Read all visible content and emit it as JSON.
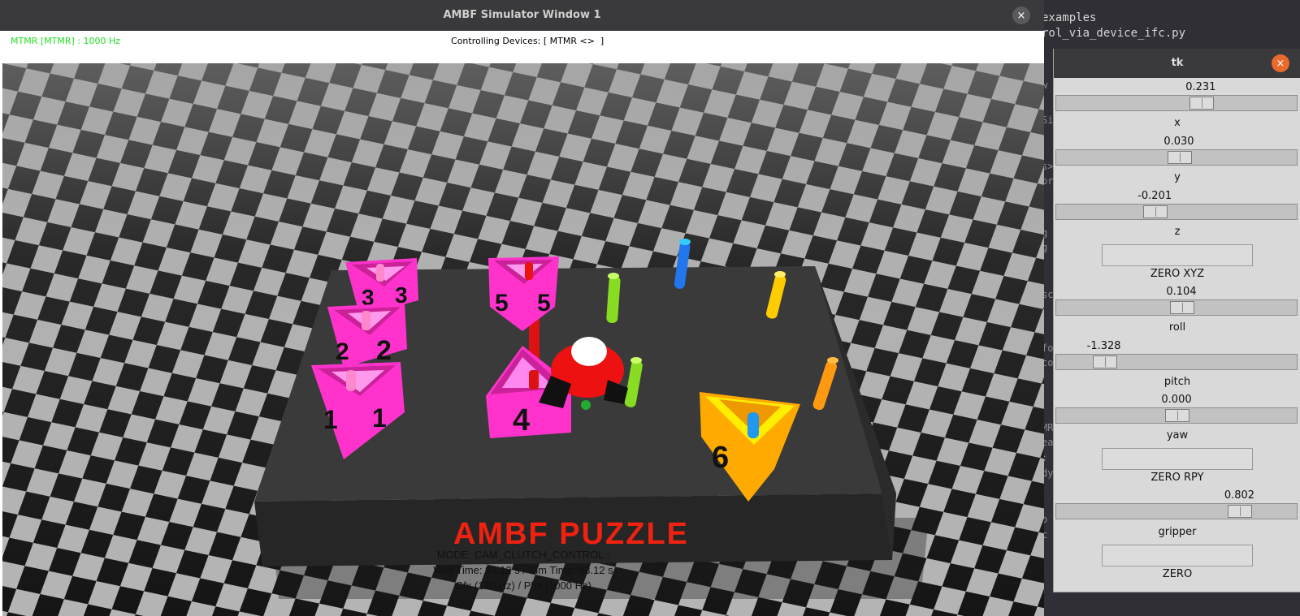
{
  "terminal": {
    "line1": "examples",
    "line2": "rol_via_device_ifc.py",
    "fragments": [
      "w",
      "Si",
      "s>",
      "pr",
      "g",
      "g",
      "sc",
      "fo",
      "co",
      "MR",
      "ea",
      ":",
      "dy",
      "p",
      "c"
    ]
  },
  "ambf_window": {
    "title": "AMBF Simulator Window 1",
    "close_icon": "×",
    "mtmr_status": "MTMR [MTMR] : 1000 Hz",
    "controlling_devices": "Controlling Devices: [ MTMR <>  ]",
    "scene": {
      "board_sign": "AMBF PUZZLE",
      "piece_numbers": [
        "1",
        "2",
        "3",
        "4",
        "5",
        "6"
      ]
    },
    "hud": {
      "mode": "MODE: CAM_CLUTCH_CONTROL :",
      "time": "Wall Time: 93.12 s / Sim Time: 93.12 s",
      "rates": "Gfx (120 Hz) / Phx (1000 Hz)"
    }
  },
  "tk_window": {
    "title": "tk",
    "close_icon": "×",
    "sliders": [
      {
        "value": "0.231",
        "label": "x",
        "fraction": 0.6
      },
      {
        "value": "0.030",
        "label": "y",
        "fraction": 0.51
      },
      {
        "value": "-0.201",
        "label": "z",
        "fraction": 0.41
      },
      {
        "value": "0.104",
        "label": "roll",
        "fraction": 0.52
      },
      {
        "value": "-1.328",
        "label": "pitch",
        "fraction": 0.2
      },
      {
        "value": "0.000",
        "label": "yaw",
        "fraction": 0.5
      },
      {
        "value": "0.802",
        "label": "gripper",
        "fraction": 0.76
      }
    ],
    "buttons": {
      "zero_xyz": "ZERO XYZ",
      "zero_rpy": "ZERO RPY",
      "zero": "ZERO"
    }
  },
  "colors": {
    "mtmr_status": "#22dd22",
    "puzzle_pink": "#ff33cc",
    "puzzle_orange": "#ffaa00",
    "sign_red": "#ee2211",
    "board": "#3a3a3a"
  }
}
